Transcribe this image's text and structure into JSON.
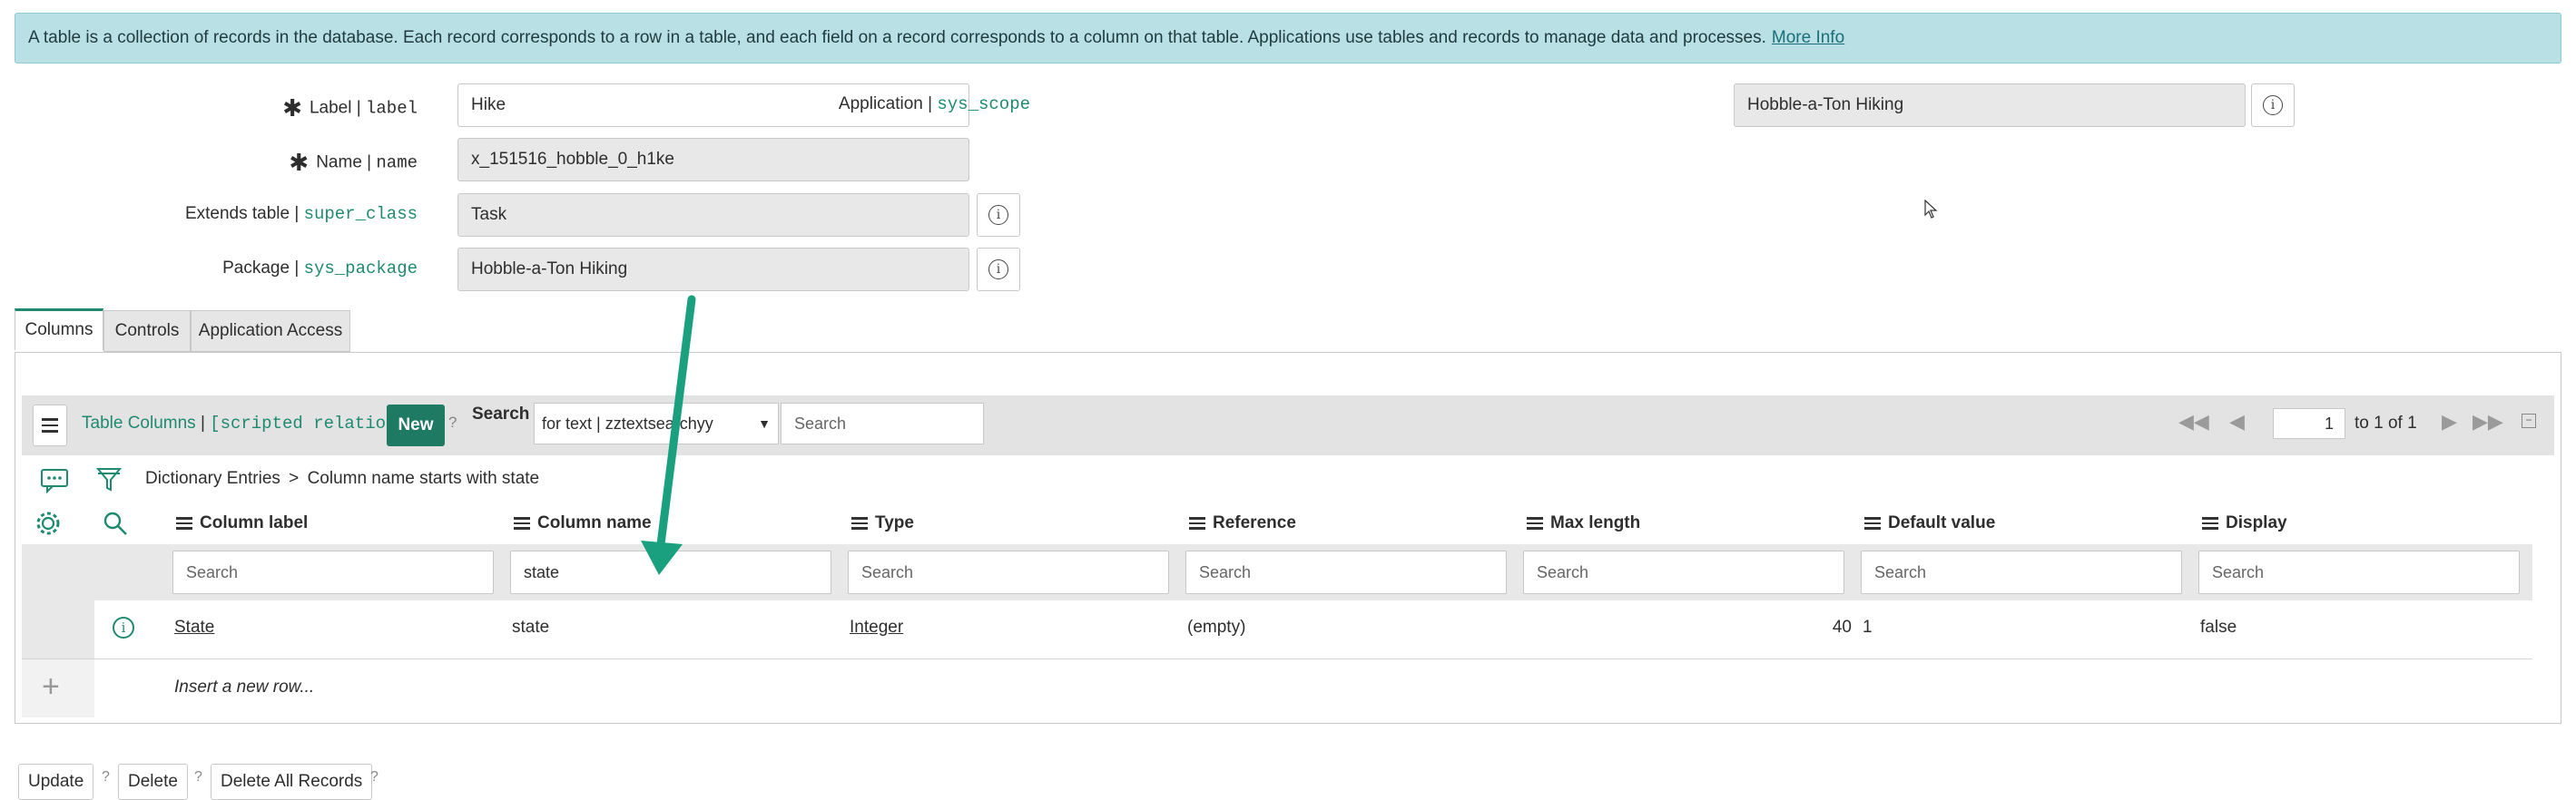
{
  "banner": {
    "text": "A table is a collection of records in the database. Each record corresponds to a row in a table, and each field on a record corresponds to a column on that table. Applications use tables and records to manage data and processes.",
    "link": "More Info"
  },
  "form": {
    "label": {
      "label": "Label",
      "sep": " | ",
      "field": "label",
      "value": "Hike"
    },
    "name": {
      "label": "Name",
      "sep": " | ",
      "field": "name",
      "value": "x_151516_hobble_0_h1ke"
    },
    "extends": {
      "label": "Extends table",
      "sep": " | ",
      "field": "super_class",
      "value": "Task"
    },
    "package": {
      "label": "Package",
      "sep": " | ",
      "field": "sys_package",
      "value": "Hobble-a-Ton Hiking"
    },
    "application": {
      "label": "Application",
      "sep": " | ",
      "field": "sys_scope",
      "value": "Hobble-a-Ton Hiking"
    }
  },
  "tabs": [
    "Columns",
    "Controls",
    "Application Access"
  ],
  "list": {
    "title": "Table Columns",
    "sep": " | ",
    "relation": "[scripted relation]",
    "new_label": "New",
    "help": "?",
    "search_label": "Search",
    "search_select": "for text | zztextsearchyy",
    "search_placeholder": "Search",
    "page_value": "1",
    "page_of": "to 1 of 1",
    "breadcrumb_root": "Dictionary Entries",
    "breadcrumb_sep": ">",
    "breadcrumb_filter": "Column name starts with state"
  },
  "columns": [
    "Column label",
    "Column name",
    "Type",
    "Reference",
    "Max length",
    "Default value",
    "Display"
  ],
  "column_search": {
    "placeholder": "Search",
    "column_name_value": "state"
  },
  "rows": [
    {
      "label": "State",
      "name": "state",
      "type": "Integer",
      "reference": "(empty)",
      "max_length": "40",
      "default": "1",
      "display": "false"
    }
  ],
  "insert_row": "Insert a new row...",
  "bottom": {
    "update": "Update",
    "delete": "Delete",
    "delete_all": "Delete All Records",
    "help": "?"
  },
  "colors": {
    "accent": "#1f8a70",
    "banner": "#b9e0e5",
    "arrow": "#1aa07e"
  }
}
